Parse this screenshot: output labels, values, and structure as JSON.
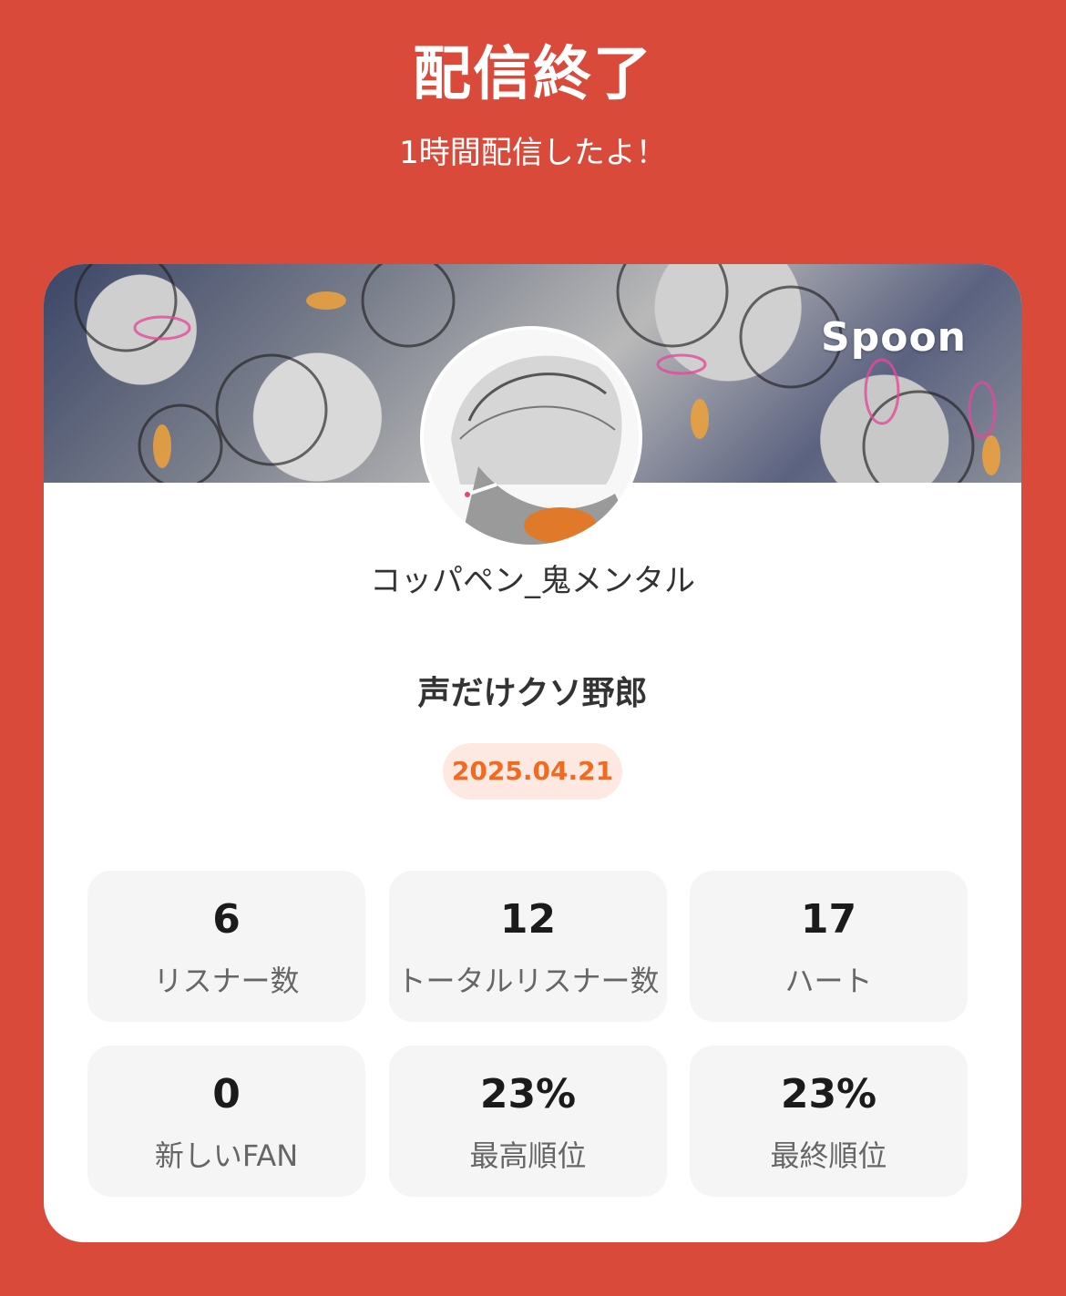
{
  "header": {
    "title": "配信終了",
    "subtitle": "1時間配信したよ！"
  },
  "card": {
    "brand": "Spoon",
    "username": "コッパペン_鬼メンタル",
    "show_title": "声だけクソ野郎",
    "date": "2025.04.21"
  },
  "stats": [
    {
      "value": "6",
      "label": "リスナー数"
    },
    {
      "value": "12",
      "label": "トータルリスナー数"
    },
    {
      "value": "17",
      "label": "ハート"
    },
    {
      "value": "0",
      "label": "新しいFAN"
    },
    {
      "value": "23%",
      "label": "最高順位"
    },
    {
      "value": "23%",
      "label": "最終順位"
    }
  ],
  "colors": {
    "background": "#d94a3b",
    "date_text": "#f16a1f",
    "date_pill": "#fde9e1",
    "stat_tile": "#f5f5f5"
  }
}
